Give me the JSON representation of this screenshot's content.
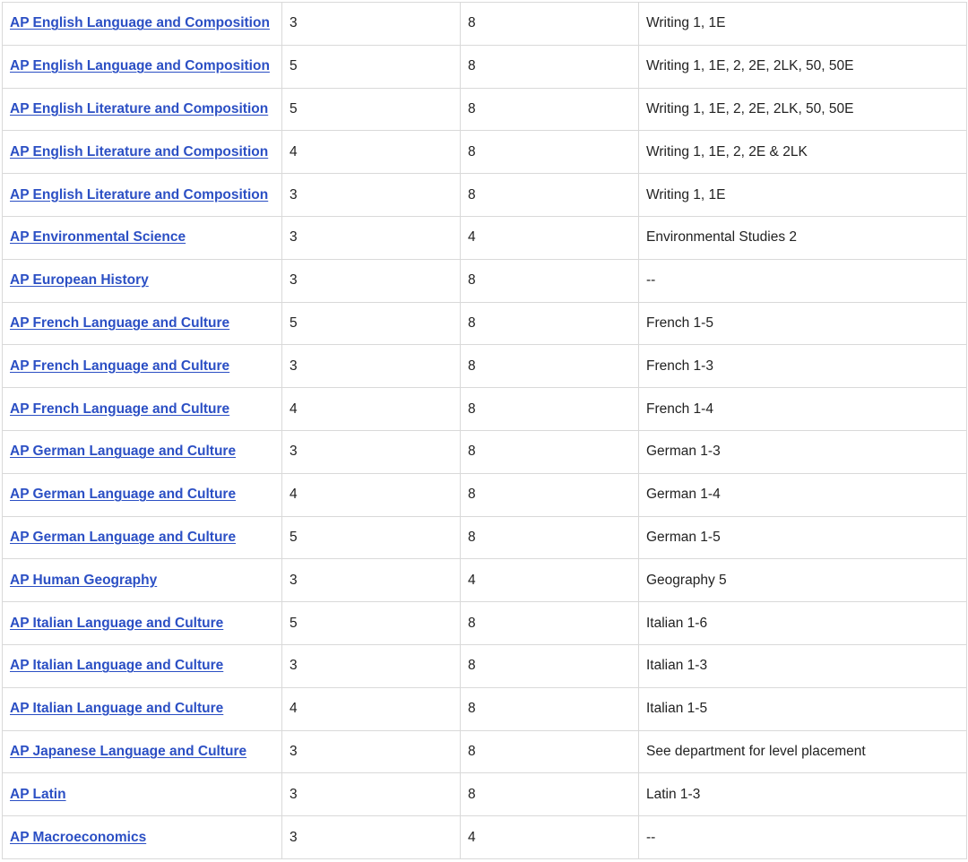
{
  "table": {
    "rows": [
      {
        "course": "AP English Language and Composition",
        "score": "3",
        "credits": "8",
        "equivalent": "Writing 1, 1E"
      },
      {
        "course": "AP English Language and Composition",
        "score": "5",
        "credits": "8",
        "equivalent": "Writing 1, 1E, 2, 2E, 2LK, 50, 50E"
      },
      {
        "course": "AP English Literature and Composition",
        "score": "5",
        "credits": "8",
        "equivalent": "Writing 1, 1E, 2, 2E, 2LK, 50, 50E"
      },
      {
        "course": "AP English Literature and Composition",
        "score": "4",
        "credits": "8",
        "equivalent": "Writing 1, 1E, 2, 2E & 2LK"
      },
      {
        "course": "AP English Literature and Composition",
        "score": "3",
        "credits": "8",
        "equivalent": "Writing 1, 1E"
      },
      {
        "course": "AP Environmental Science",
        "score": "3",
        "credits": "4",
        "equivalent": "Environmental Studies 2"
      },
      {
        "course": "AP European History",
        "score": "3",
        "credits": "8",
        "equivalent": "--"
      },
      {
        "course": "AP French Language and Culture",
        "score": "5",
        "credits": "8",
        "equivalent": "French 1-5"
      },
      {
        "course": "AP French Language and Culture",
        "score": "3",
        "credits": "8",
        "equivalent": "French 1-3"
      },
      {
        "course": "AP French Language and Culture",
        "score": "4",
        "credits": "8",
        "equivalent": "French 1-4"
      },
      {
        "course": "AP German Language and Culture",
        "score": "3",
        "credits": "8",
        "equivalent": "German 1-3"
      },
      {
        "course": "AP German Language and Culture",
        "score": "4",
        "credits": "8",
        "equivalent": "German 1-4"
      },
      {
        "course": "AP German Language and Culture",
        "score": "5",
        "credits": "8",
        "equivalent": "German 1-5"
      },
      {
        "course": "AP Human Geography",
        "score": "3",
        "credits": "4",
        "equivalent": "Geography 5"
      },
      {
        "course": "AP Italian Language and Culture",
        "score": "5",
        "credits": "8",
        "equivalent": "Italian 1-6"
      },
      {
        "course": "AP Italian Language and Culture",
        "score": "3",
        "credits": "8",
        "equivalent": "Italian 1-3"
      },
      {
        "course": "AP Italian Language and Culture",
        "score": "4",
        "credits": "8",
        "equivalent": "Italian 1-5"
      },
      {
        "course": "AP Japanese Language and Culture",
        "score": "3",
        "credits": "8",
        "equivalent": "See department for level placement"
      },
      {
        "course": "AP Latin",
        "score": "3",
        "credits": "8",
        "equivalent": "Latin 1-3"
      },
      {
        "course": "AP Macroeconomics",
        "score": "3",
        "credits": "4",
        "equivalent": "--"
      }
    ]
  },
  "colors": {
    "link": "#2b4fc4",
    "border": "#d9d9d9",
    "text": "#222222"
  }
}
